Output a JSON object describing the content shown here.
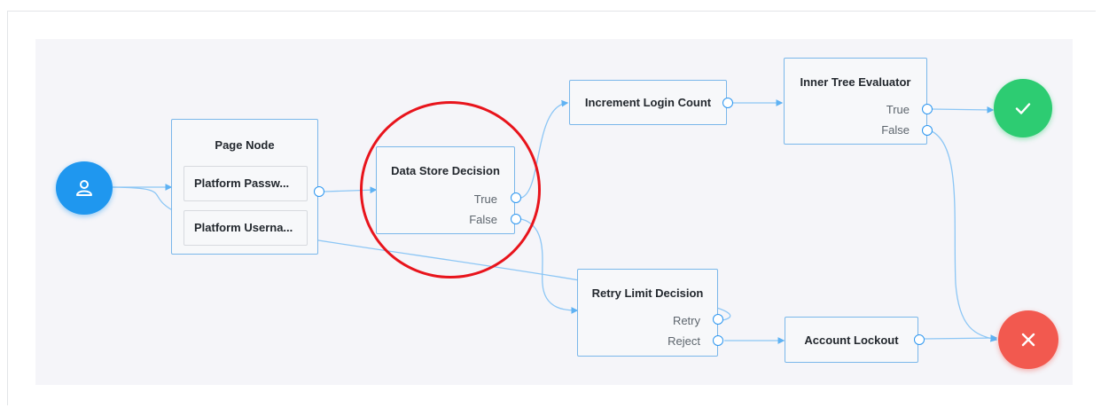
{
  "diagram": {
    "start_node": {
      "icon": "user-icon"
    },
    "page_node": {
      "title": "Page Node",
      "children": [
        "Platform Passw...",
        "Platform Userna..."
      ]
    },
    "data_store_decision": {
      "title": "Data Store Decision",
      "outcomes": [
        "True",
        "False"
      ]
    },
    "increment_login_count": {
      "title": "Increment Login Count"
    },
    "inner_tree_evaluator": {
      "title": "Inner Tree Evaluator",
      "outcomes": [
        "True",
        "False"
      ]
    },
    "retry_limit_decision": {
      "title": "Retry Limit Decision",
      "outcomes": [
        "Retry",
        "Reject"
      ]
    },
    "account_lockout": {
      "title": "Account Lockout"
    },
    "success_node": {
      "icon": "checkmark-icon"
    },
    "failure_node": {
      "icon": "x-icon"
    }
  },
  "colors": {
    "accent": "#2c96f0",
    "success": "#2dcc72",
    "failure": "#f2594f",
    "highlight": "#e8141c"
  }
}
